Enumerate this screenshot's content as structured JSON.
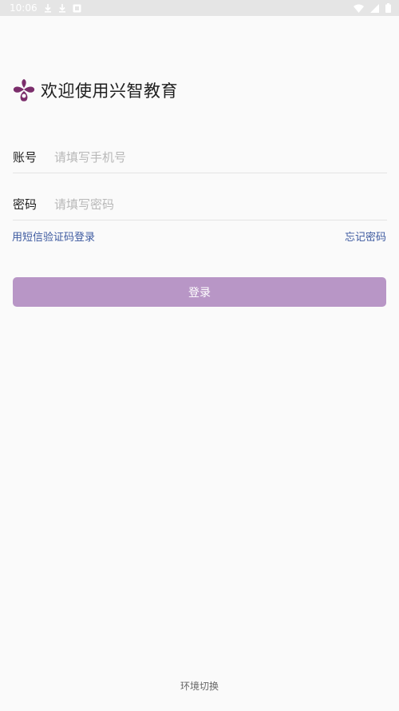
{
  "status_bar": {
    "time": "10:06",
    "left_icons": [
      "download-icon",
      "download-icon",
      "app-notification-icon"
    ],
    "right_icons": [
      "wifi-icon",
      "signal-icon",
      "battery-icon"
    ]
  },
  "header": {
    "logo_icon": "xingzhi-logo-icon",
    "title": "欢迎使用兴智教育"
  },
  "form": {
    "account_label": "账号",
    "account_placeholder": "请填写手机号",
    "password_label": "密码",
    "password_placeholder": "请填写密码",
    "sms_login_link": "用短信验证码登录",
    "forgot_password_link": "忘记密码",
    "login_button": "登录"
  },
  "footer": {
    "env_switch": "环境切换"
  },
  "colors": {
    "accent": "#b896c6",
    "logo": "#7b2d6b",
    "link": "#3d5aa0",
    "background": "#fafafa"
  }
}
